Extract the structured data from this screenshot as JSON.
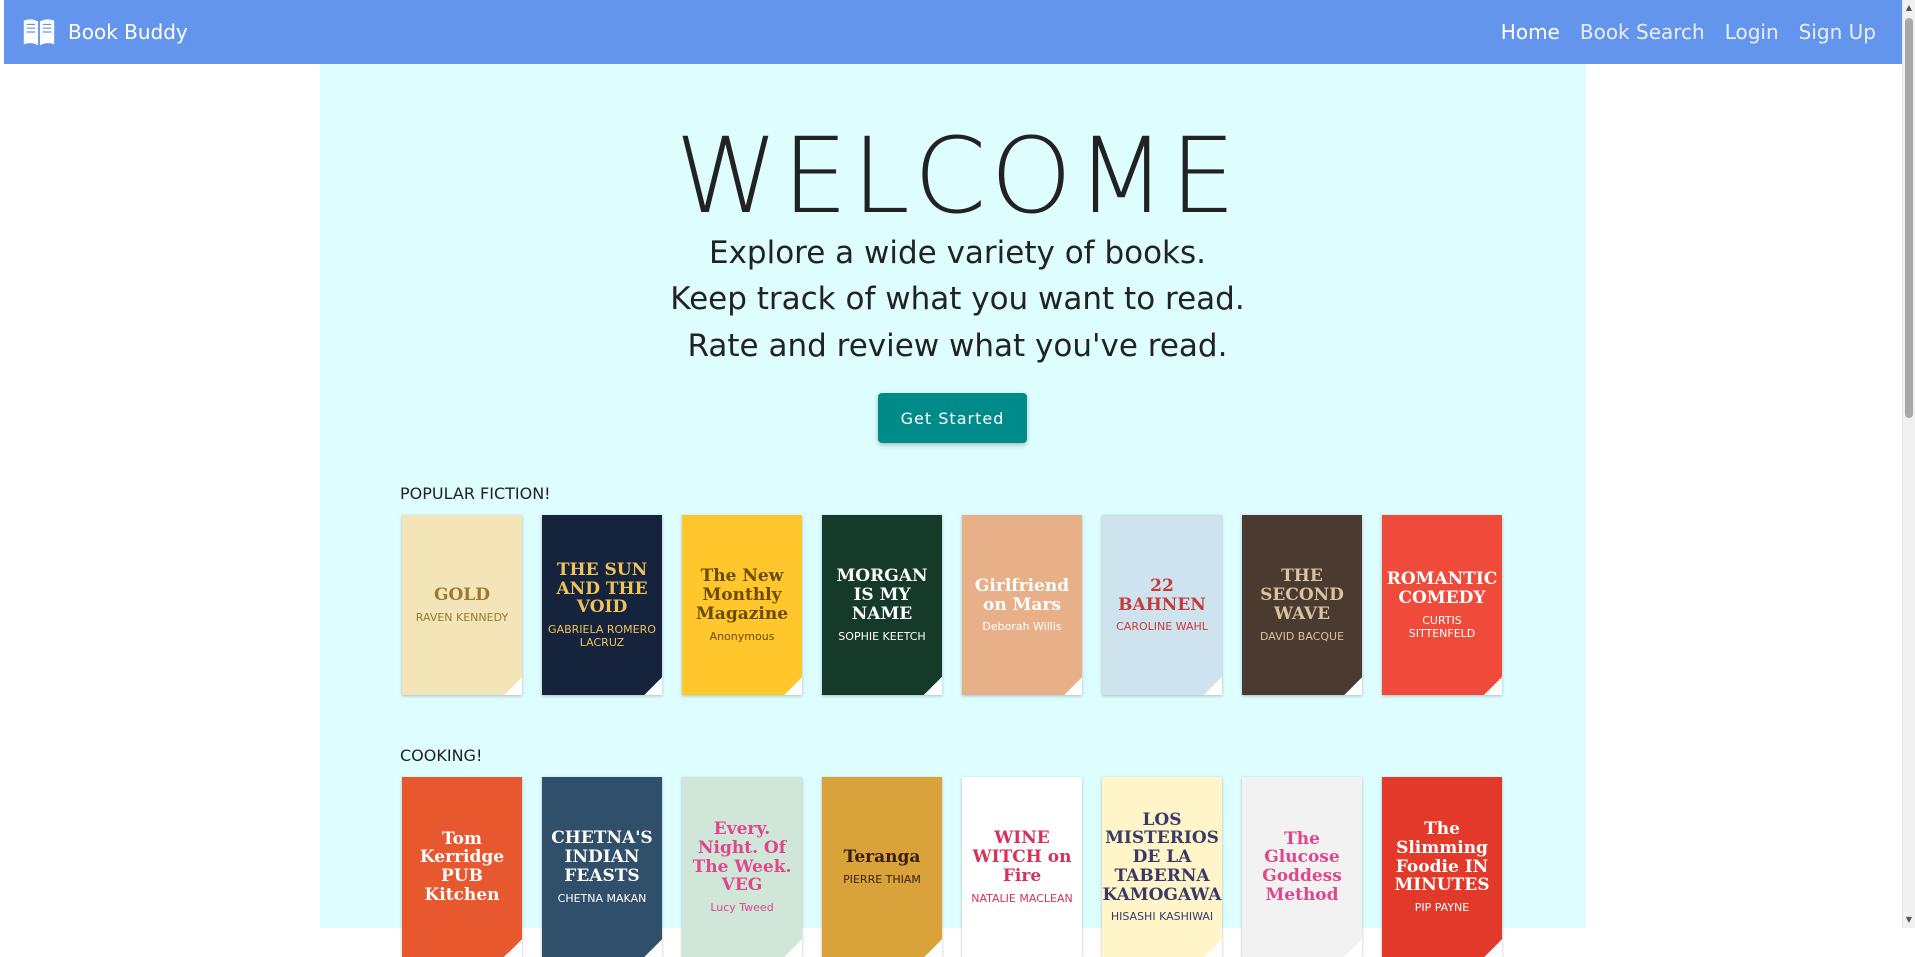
{
  "navbar": {
    "brand": "Book Buddy",
    "links": [
      "Home",
      "Book Search",
      "Login",
      "Sign Up"
    ],
    "active": "Home",
    "color": "#6495ed"
  },
  "hero": {
    "heading": "WELCOME",
    "lines": [
      "Explore a wide variety of books.",
      "Keep track of what you want to read.",
      "Rate and review what you've read."
    ],
    "cta": "Get Started",
    "background": "#ddfdff",
    "cta_color": "#008b8b"
  },
  "sections": [
    {
      "title": "POPULAR FICTION!",
      "books": [
        {
          "cover_text": "GOLD",
          "author_text": "RAVEN KENNEDY",
          "bg": "#f3e5b8",
          "fg": "#9b7a2f"
        },
        {
          "cover_text": "THE SUN AND THE VOID",
          "author_text": "GABRIELA ROMERO LACRUZ",
          "bg": "#15233d",
          "fg": "#f0c25a"
        },
        {
          "cover_text": "The New Monthly Magazine",
          "author_text": "Anonymous",
          "bg": "#ffc72c",
          "fg": "#6b4b00"
        },
        {
          "cover_text": "MORGAN IS MY NAME",
          "author_text": "SOPHIE KEETCH",
          "bg": "#163a2a",
          "fg": "#ffffff"
        },
        {
          "cover_text": "Girlfriend on Mars",
          "author_text": "Deborah Willis",
          "bg": "#e8b089",
          "fg": "#ffffff"
        },
        {
          "cover_text": "22 BAHNEN",
          "author_text": "CAROLINE WAHL",
          "bg": "#cfe3ef",
          "fg": "#c63a3a"
        },
        {
          "cover_text": "THE SECOND WAVE",
          "author_text": "DAVID BACQUE",
          "bg": "#4a3a30",
          "fg": "#d9c3a0"
        },
        {
          "cover_text": "ROMANTIC COMEDY",
          "author_text": "CURTIS SITTENFELD",
          "bg": "#f04a3a",
          "fg": "#ffffff"
        }
      ]
    },
    {
      "title": "COOKING!",
      "books": [
        {
          "cover_text": "Tom Kerridge PUB Kitchen",
          "author_text": "",
          "bg": "#e8582f",
          "fg": "#ffffff"
        },
        {
          "cover_text": "CHETNA'S INDIAN FEASTS",
          "author_text": "CHETNA MAKAN",
          "bg": "#2f4f6a",
          "fg": "#ffffff"
        },
        {
          "cover_text": "Every. Night. Of The Week. VEG",
          "author_text": "Lucy Tweed",
          "bg": "#cfe6d9",
          "fg": "#e0478a"
        },
        {
          "cover_text": "Teranga",
          "author_text": "PIERRE THIAM",
          "bg": "#d9a23a",
          "fg": "#3a1f0a"
        },
        {
          "cover_text": "WINE WITCH on Fire",
          "author_text": "NATALIE MACLEAN",
          "bg": "#ffffff",
          "fg": "#d6315a"
        },
        {
          "cover_text": "LOS MISTERIOS DE LA TABERNA KAMOGAWA",
          "author_text": "HISASHI KASHIWAI",
          "bg": "#fff5c9",
          "fg": "#3a3a6a"
        },
        {
          "cover_text": "The Glucose Goddess Method",
          "author_text": "",
          "bg": "#f2f2f2",
          "fg": "#e0478a"
        },
        {
          "cover_text": "The Slimming Foodie IN MINUTES",
          "author_text": "PIP PAYNE",
          "bg": "#e2392b",
          "fg": "#ffffff"
        }
      ]
    }
  ]
}
